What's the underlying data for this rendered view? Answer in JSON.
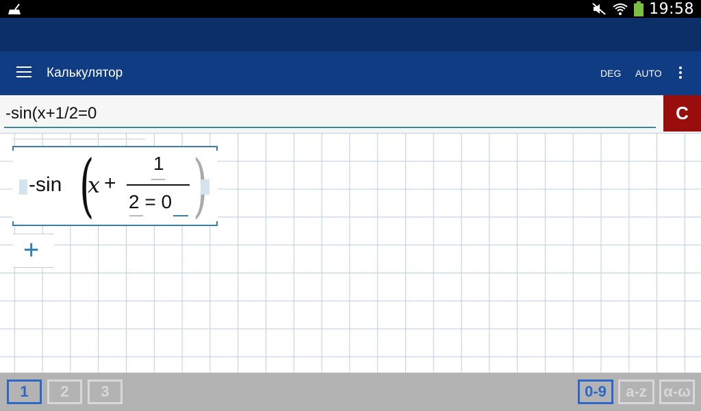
{
  "status_bar": {
    "time": "19:58"
  },
  "toolbar": {
    "title": "Калькулятор",
    "deg": "DEG",
    "auto": "AUTO"
  },
  "input": {
    "value": "-sin(x+1/2=0"
  },
  "clear": {
    "label": "C"
  },
  "formula": {
    "prefix": "-sin",
    "variable": "x",
    "plus": "+",
    "numerator": "1",
    "denominator": "2 = 0"
  },
  "bottom": {
    "pages": [
      "1",
      "2",
      "3"
    ],
    "keyboards": [
      "0-9",
      "a-z",
      "α-ω"
    ]
  },
  "colors": {
    "accent": "#2a67c8",
    "toolbar": "#0f3c83",
    "clear": "#9a0d0d"
  }
}
